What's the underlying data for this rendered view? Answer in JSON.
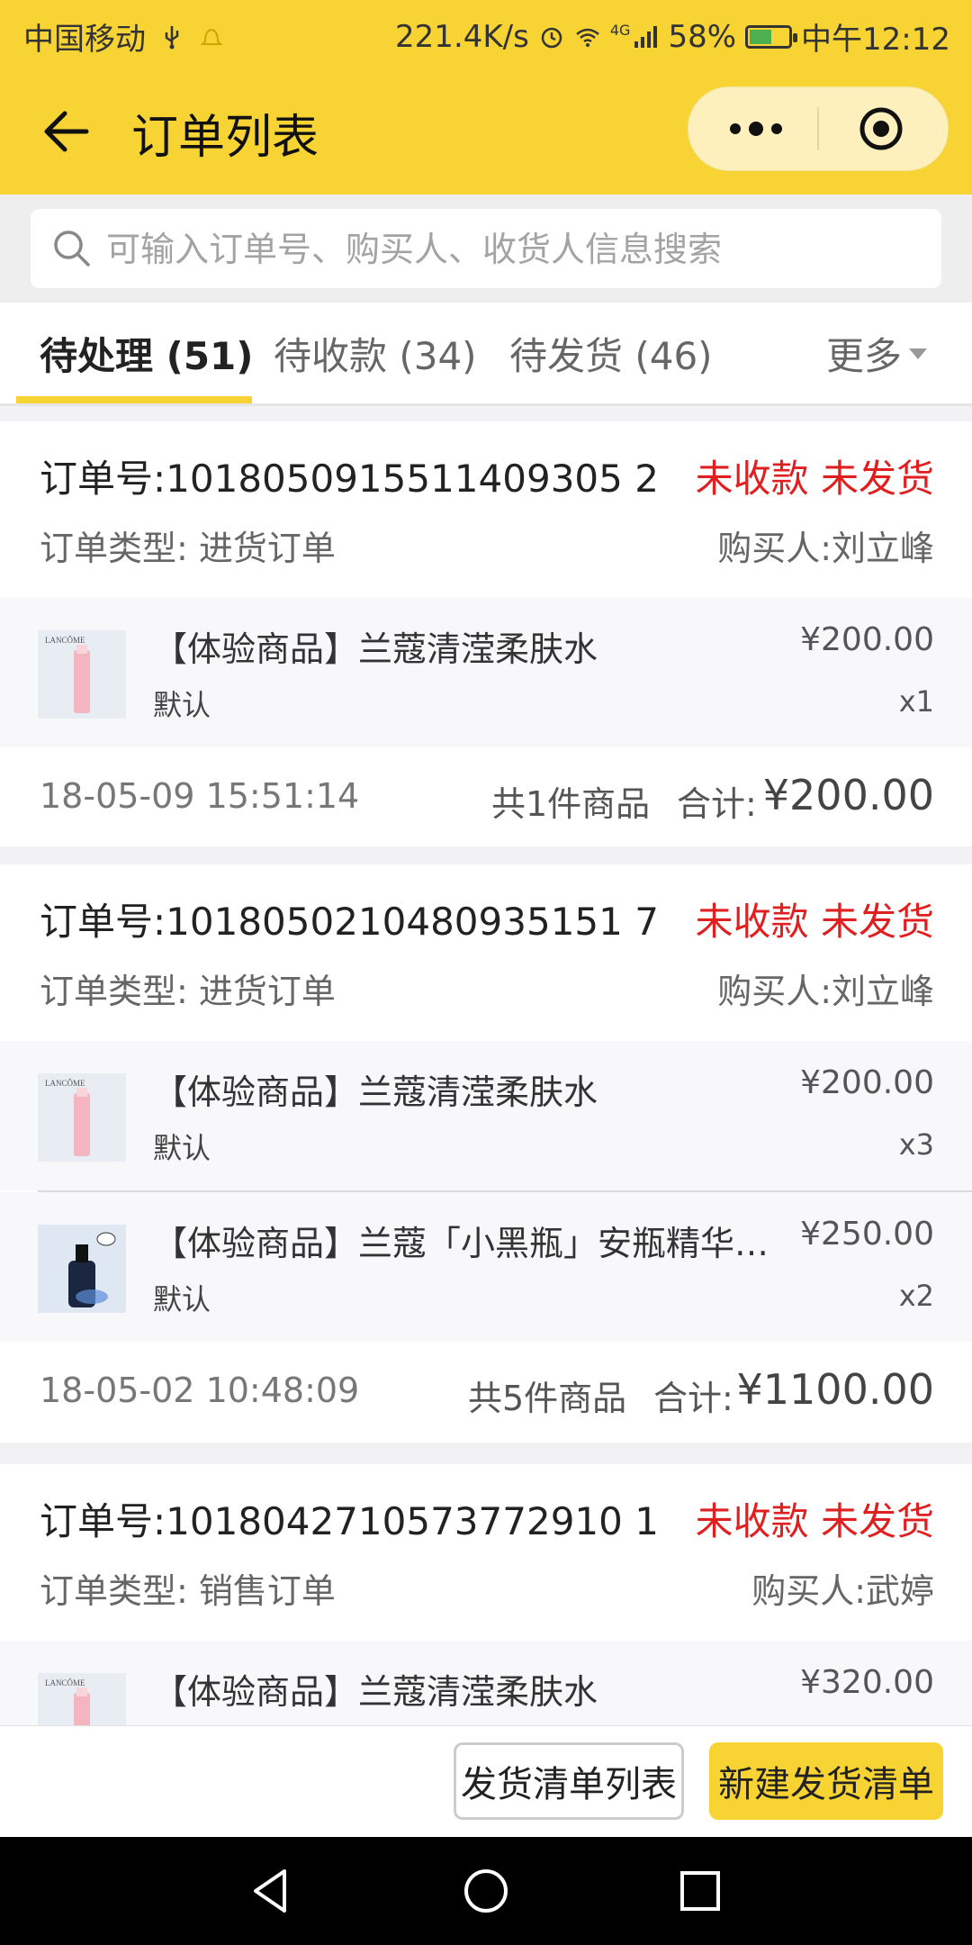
{
  "status_bar": {
    "carrier": "中国移动",
    "speed": "221.4K/s",
    "network": "4G",
    "battery": "58%",
    "battery_level": 0.58,
    "time": "中午12:12"
  },
  "app_bar": {
    "title": "订单列表"
  },
  "search": {
    "placeholder": "可输入订单号、购买人、收货人信息搜索",
    "value": ""
  },
  "tabs": [
    {
      "label": "待处理 (51)",
      "active": true
    },
    {
      "label": "待收款 (34)",
      "active": false
    },
    {
      "label": "待发货 (46)",
      "active": false
    }
  ],
  "tabs_more": "更多",
  "orders": [
    {
      "order_no": "订单号:1018050915511409305 2",
      "status": "未收款 未发货",
      "type": "订单类型: 进货订单",
      "buyer": "购买人:刘立峰",
      "items": [
        {
          "name": "【体验商品】兰蔻清滢柔肤水",
          "sku": "默认",
          "price": "¥200.00",
          "qty": "x1"
        }
      ],
      "time": "18-05-09 15:51:14",
      "count": "共1件商品",
      "total_label": "合计:",
      "total": "¥200.00"
    },
    {
      "order_no": "订单号:1018050210480935151 7",
      "status": "未收款 未发货",
      "type": "订单类型: 进货订单",
      "buyer": "购买人:刘立峰",
      "items": [
        {
          "name": "【体验商品】兰蔻清滢柔肤水",
          "sku": "默认",
          "price": "¥200.00",
          "qty": "x3"
        },
        {
          "name": "【体验商品】兰蔻「小黑瓶」安瓶精华…",
          "sku": "默认",
          "price": "¥250.00",
          "qty": "x2"
        }
      ],
      "time": "18-05-02 10:48:09",
      "count": "共5件商品",
      "total_label": "合计:",
      "total": "¥1100.00"
    },
    {
      "order_no": "订单号:1018042710573772910 1",
      "status": "未收款 未发货",
      "type": "订单类型: 销售订单",
      "buyer": "购买人:武婷",
      "items": [
        {
          "name": "【体验商品】兰蔻清滢柔肤水",
          "price": "¥320.00"
        }
      ]
    }
  ],
  "bottom_actions": {
    "list_button": "发货清单列表",
    "new_button": "新建发货清单"
  },
  "colors": {
    "brand_yellow": "#f8d334",
    "status_red": "#e02020"
  },
  "icons": [
    "back-arrow-icon",
    "more-dots-icon",
    "target-icon",
    "search-icon",
    "chevron-down-icon",
    "nav-back-icon",
    "nav-home-icon",
    "nav-recents-icon"
  ]
}
